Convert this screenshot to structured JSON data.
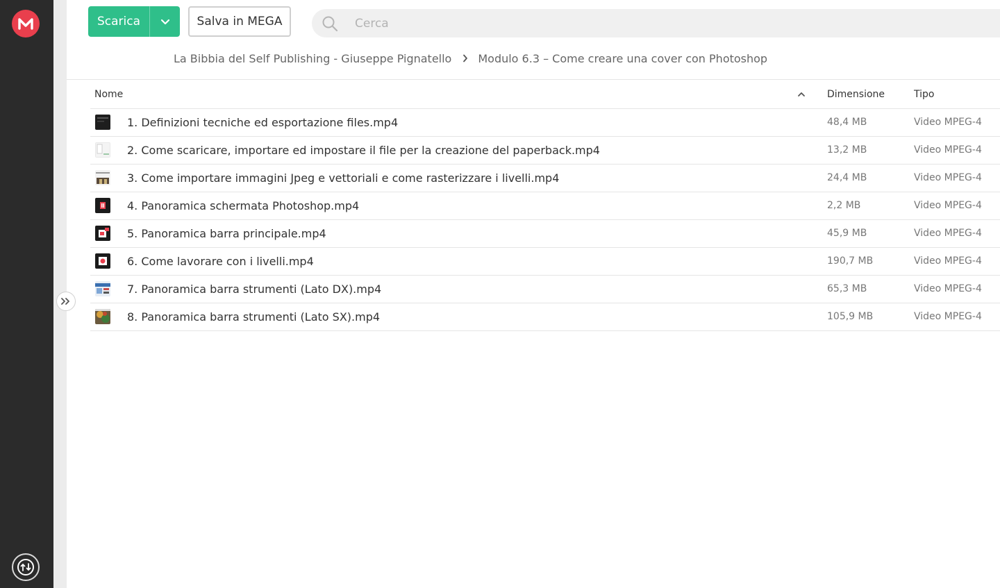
{
  "toolbar": {
    "download_label": "Scarica",
    "save_label": "Salva in MEGA"
  },
  "search": {
    "placeholder": "Cerca"
  },
  "breadcrumb": [
    "La Bibbia del Self Publishing - Giuseppe Pignatello",
    "Modulo 6.3 – Come creare una cover con Photoshop"
  ],
  "table": {
    "columns": {
      "name": "Nome",
      "size": "Dimensione",
      "type": "Tipo"
    },
    "sort": "ascending",
    "rows": [
      {
        "name": "1. Definizioni tecniche ed esportazione files.mp4",
        "size": "48,4 MB",
        "type": "Video MPEG-4",
        "thumb": "dark-screen"
      },
      {
        "name": "2. Come scaricare, importare ed impostare il file per la creazione del paperback.mp4",
        "size": "13,2 MB",
        "type": "Video MPEG-4",
        "thumb": "light-document"
      },
      {
        "name": "3. Come importare immagini Jpeg e vettoriali e come rasterizzare i livelli.mp4",
        "size": "24,4 MB",
        "type": "Video MPEG-4",
        "thumb": "book-cover"
      },
      {
        "name": "4. Panoramica schermata Photoshop.mp4",
        "size": "2,2 MB",
        "type": "Video MPEG-4",
        "thumb": "photoshop-grid"
      },
      {
        "name": "5. Panoramica barra principale.mp4",
        "size": "45,9 MB",
        "type": "Video MPEG-4",
        "thumb": "photoshop-menu"
      },
      {
        "name": "6. Come lavorare con i livelli.mp4",
        "size": "190,7 MB",
        "type": "Video MPEG-4",
        "thumb": "photoshop-layer"
      },
      {
        "name": "7. Panoramica barra strumenti (Lato DX).mp4",
        "size": "65,3 MB",
        "type": "Video MPEG-4",
        "thumb": "blue-screen"
      },
      {
        "name": "8. Panoramica barra strumenti (Lato SX).mp4",
        "size": "105,9 MB",
        "type": "Video MPEG-4",
        "thumb": "colorful-photo"
      }
    ]
  },
  "colors": {
    "brand": "#e93f4d",
    "download_button": "#2fbf8a",
    "sidebar": "#2b2b2b"
  }
}
